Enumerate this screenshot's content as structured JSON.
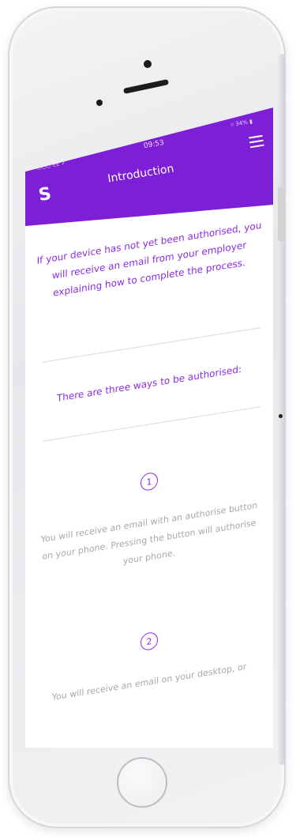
{
  "status_bar": {
    "time": "09:53",
    "carrier": "••○○○ EE ✓",
    "battery": "⌾ 34% ▮"
  },
  "header": {
    "title": "Introduction",
    "logo_glyph": "S",
    "menu_icon": "hamburger-menu-icon",
    "background_color": "#7d1fd6"
  },
  "content": {
    "intro": "If your device has not yet been authorised, you will receive an email from your employer explaining how to complete the process.",
    "ways_heading": "There are three ways to be authorised:",
    "steps": [
      {
        "number": "1",
        "text": "You will receive an email with an authorise button on your phone. Pressing the button will authorise your phone."
      },
      {
        "number": "2",
        "text": "You will receive an email on your desktop, or"
      }
    ]
  },
  "colors": {
    "accent": "#8a2be2",
    "muted_text": "#a7a7ae"
  }
}
